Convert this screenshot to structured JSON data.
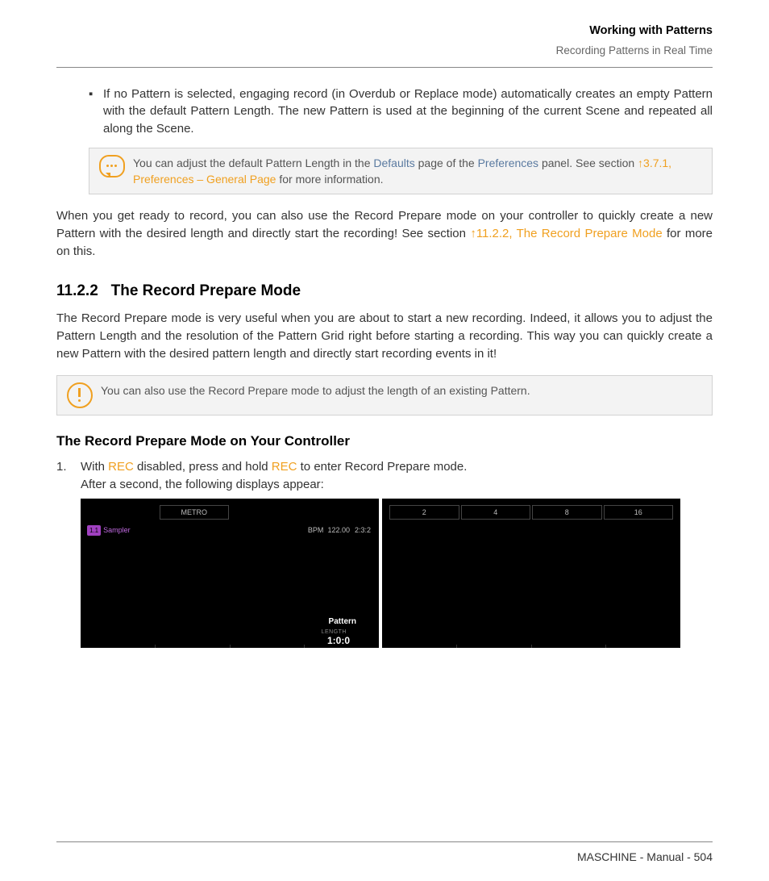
{
  "header": {
    "title": "Working with Patterns",
    "subtitle": "Recording Patterns in Real Time"
  },
  "bullet1_pre": "If no Pattern is selected, engaging record (in Overdub or Replace mode) automatically creates an empty Pattern with the default Pattern Length. The new Pattern is used at the beginning of the current Scene and repeated all along the Scene.",
  "callout1": {
    "pre": "You can adjust the default Pattern Length in the ",
    "l1": "Defaults",
    "mid": " page of the ",
    "l2": "Preferences",
    "post": " panel. See section ",
    "xref": "↑3.7.1, Preferences – General Page",
    "end": " for more information."
  },
  "para2": {
    "pre": "When you get ready to record, you can also use the Record Prepare mode on your controller to quickly create a new Pattern with the desired length and directly start the recording! See section ",
    "xref": "↑11.2.2, The Record Prepare Mode",
    "end": " for more on this."
  },
  "section": {
    "num": "11.2.2",
    "title": "The Record Prepare Mode"
  },
  "para3": "The Record Prepare mode is very useful when you are about to start a new recording. Indeed, it allows you to adjust the Pattern Length and the resolution of the Pattern Grid right before starting a recording. This way you can quickly create a new Pattern with the desired pattern length and directly start recording events in it!",
  "callout2": "You can also use the Record Prepare mode to adjust the length of an existing Pattern.",
  "subsection": "The Record Prepare Mode on Your Controller",
  "step1": {
    "num": "1.",
    "t1": "With ",
    "kw1": "REC",
    "t2": " disabled, press and hold ",
    "kw2": "REC",
    "t3": " to enter Record Prepare mode.",
    "line2": "After a second, the following displays appear:"
  },
  "display": {
    "metro": "METRO",
    "chip": "1.1",
    "sampler": "Sampler",
    "bpm_label": "BPM",
    "bpm_value": "122.00",
    "position": "2:3:2",
    "pattern": "Pattern",
    "length_label": "LENGTH",
    "length_value": "1:0:0",
    "tabs": [
      "2",
      "4",
      "8",
      "16"
    ]
  },
  "footer": "MASCHINE - Manual - 504"
}
